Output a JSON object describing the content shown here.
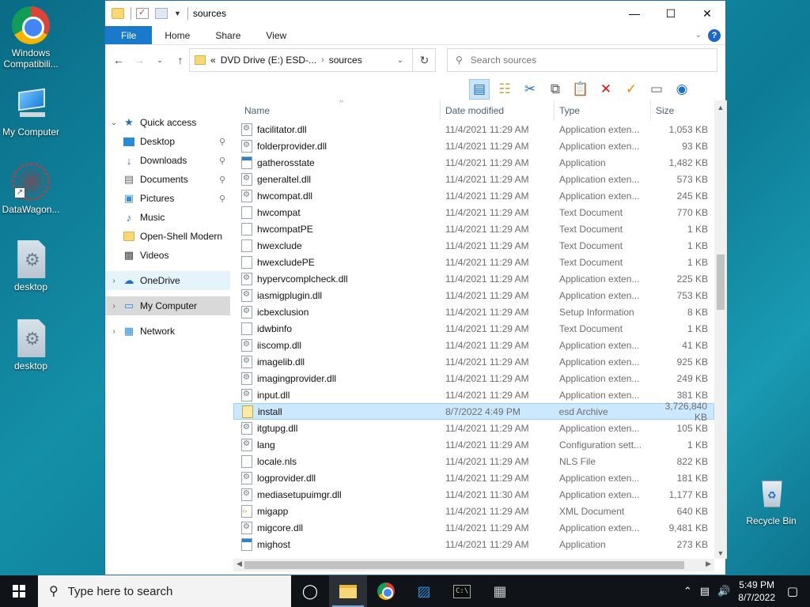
{
  "desktop": {
    "icons": [
      {
        "label": "Windows Compatibili...",
        "icon": "chrome-icon"
      },
      {
        "label": "My Computer",
        "icon": "computer-icon"
      },
      {
        "label": "DataWagon...",
        "icon": "web-shortcut-icon"
      },
      {
        "label": "desktop",
        "icon": "settings-file-icon"
      },
      {
        "label": "desktop",
        "icon": "settings-file-icon"
      },
      {
        "label": "Recycle Bin",
        "icon": "recycle-bin-icon"
      }
    ]
  },
  "window": {
    "title": "sources",
    "ribbon_tabs": [
      "File",
      "Home",
      "Share",
      "View"
    ],
    "address": {
      "prefix": "«",
      "segment1": "DVD Drive (E:) ESD-...",
      "segment2": "sources"
    },
    "search_placeholder": "Search sources",
    "nav": [
      {
        "label": "Quick access",
        "icon": "star-icon"
      },
      {
        "label": "Desktop",
        "icon": "desktop-folder-icon"
      },
      {
        "label": "Downloads",
        "icon": "download-icon"
      },
      {
        "label": "Documents",
        "icon": "documents-icon"
      },
      {
        "label": "Pictures",
        "icon": "pictures-icon"
      },
      {
        "label": "Music",
        "icon": "music-icon"
      },
      {
        "label": "Open-Shell Modern",
        "icon": "folder-icon"
      },
      {
        "label": "Videos",
        "icon": "videos-icon"
      },
      {
        "label": "OneDrive",
        "icon": "cloud-icon"
      },
      {
        "label": "My Computer",
        "icon": "computer-icon"
      },
      {
        "label": "Network",
        "icon": "network-icon"
      }
    ],
    "columns": [
      "Name",
      "Date modified",
      "Type",
      "Size"
    ],
    "files": [
      {
        "name": "facilitator.dll",
        "date": "11/4/2021 11:29 AM",
        "type": "Application exten...",
        "size": "1,053 KB",
        "kind": "dll"
      },
      {
        "name": "folderprovider.dll",
        "date": "11/4/2021 11:29 AM",
        "type": "Application exten...",
        "size": "93 KB",
        "kind": "dll"
      },
      {
        "name": "gatherosstate",
        "date": "11/4/2021 11:29 AM",
        "type": "Application",
        "size": "1,482 KB",
        "kind": "app"
      },
      {
        "name": "generaltel.dll",
        "date": "11/4/2021 11:29 AM",
        "type": "Application exten...",
        "size": "573 KB",
        "kind": "dll"
      },
      {
        "name": "hwcompat.dll",
        "date": "11/4/2021 11:29 AM",
        "type": "Application exten...",
        "size": "245 KB",
        "kind": "dll"
      },
      {
        "name": "hwcompat",
        "date": "11/4/2021 11:29 AM",
        "type": "Text Document",
        "size": "770 KB",
        "kind": "txt"
      },
      {
        "name": "hwcompatPE",
        "date": "11/4/2021 11:29 AM",
        "type": "Text Document",
        "size": "1 KB",
        "kind": "txt"
      },
      {
        "name": "hwexclude",
        "date": "11/4/2021 11:29 AM",
        "type": "Text Document",
        "size": "1 KB",
        "kind": "txt"
      },
      {
        "name": "hwexcludePE",
        "date": "11/4/2021 11:29 AM",
        "type": "Text Document",
        "size": "1 KB",
        "kind": "txt"
      },
      {
        "name": "hypervcomplcheck.dll",
        "date": "11/4/2021 11:29 AM",
        "type": "Application exten...",
        "size": "225 KB",
        "kind": "dll"
      },
      {
        "name": "iasmigplugin.dll",
        "date": "11/4/2021 11:29 AM",
        "type": "Application exten...",
        "size": "753 KB",
        "kind": "dll"
      },
      {
        "name": "icbexclusion",
        "date": "11/4/2021 11:29 AM",
        "type": "Setup Information",
        "size": "8 KB",
        "kind": "dll"
      },
      {
        "name": "idwbinfo",
        "date": "11/4/2021 11:29 AM",
        "type": "Text Document",
        "size": "1 KB",
        "kind": "txt"
      },
      {
        "name": "iiscomp.dll",
        "date": "11/4/2021 11:29 AM",
        "type": "Application exten...",
        "size": "41 KB",
        "kind": "dll"
      },
      {
        "name": "imagelib.dll",
        "date": "11/4/2021 11:29 AM",
        "type": "Application exten...",
        "size": "925 KB",
        "kind": "dll"
      },
      {
        "name": "imagingprovider.dll",
        "date": "11/4/2021 11:29 AM",
        "type": "Application exten...",
        "size": "249 KB",
        "kind": "dll"
      },
      {
        "name": "input.dll",
        "date": "11/4/2021 11:29 AM",
        "type": "Application exten...",
        "size": "381 KB",
        "kind": "dll"
      },
      {
        "name": "install",
        "date": "8/7/2022 4:49 PM",
        "type": "esd Archive",
        "size": "3,726,840 KB",
        "kind": "esd",
        "selected": true
      },
      {
        "name": "itgtupg.dll",
        "date": "11/4/2021 11:29 AM",
        "type": "Application exten...",
        "size": "105 KB",
        "kind": "dll"
      },
      {
        "name": "lang",
        "date": "11/4/2021 11:29 AM",
        "type": "Configuration sett...",
        "size": "1 KB",
        "kind": "dll"
      },
      {
        "name": "locale.nls",
        "date": "11/4/2021 11:29 AM",
        "type": "NLS File",
        "size": "822 KB",
        "kind": "txt"
      },
      {
        "name": "logprovider.dll",
        "date": "11/4/2021 11:29 AM",
        "type": "Application exten...",
        "size": "181 KB",
        "kind": "dll"
      },
      {
        "name": "mediasetupuimgr.dll",
        "date": "11/4/2021 11:30 AM",
        "type": "Application exten...",
        "size": "1,177 KB",
        "kind": "dll"
      },
      {
        "name": "migapp",
        "date": "11/4/2021 11:29 AM",
        "type": "XML Document",
        "size": "640 KB",
        "kind": "xml"
      },
      {
        "name": "migcore.dll",
        "date": "11/4/2021 11:29 AM",
        "type": "Application exten...",
        "size": "9,481 KB",
        "kind": "dll"
      },
      {
        "name": "mighost",
        "date": "11/4/2021 11:29 AM",
        "type": "Application",
        "size": "273 KB",
        "kind": "app"
      }
    ]
  },
  "taskbar": {
    "search_placeholder": "Type here to search",
    "time": "5:49 PM",
    "date": "8/7/2022"
  }
}
